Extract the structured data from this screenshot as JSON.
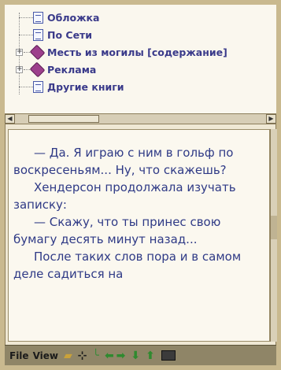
{
  "tree": {
    "items": [
      {
        "label": "Обложка",
        "icon": "document-icon",
        "expandable": false
      },
      {
        "label": "По Сети",
        "icon": "document-icon",
        "expandable": false
      },
      {
        "label": "Месть из могилы [содержание]",
        "icon": "book-icon",
        "expandable": true
      },
      {
        "label": "Реклама",
        "icon": "book-icon",
        "expandable": true
      },
      {
        "label": "Другие книги",
        "icon": "document-icon",
        "expandable": false
      }
    ]
  },
  "reader": {
    "paragraphs": [
      "— Да. Я играю с ним в гольф по воскресеньям... Ну, что скажешь?",
      "Хендерсон продолжала изучать записку:",
      "— Скажу, что ты принес свою бумагу десять минут назад...",
      "После таких слов пора и в самом деле садиться на"
    ]
  },
  "command_bar": {
    "file_label": "File",
    "view_label": "View",
    "icons": [
      "open-folder-icon",
      "split-view-icon",
      "bookmark-icon",
      "back-arrow-icon",
      "forward-arrow-icon",
      "down-arrow-icon",
      "up-arrow-icon",
      "keyboard-icon"
    ]
  },
  "colors": {
    "text": "#2f3a86",
    "tree_text": "#3a3a8a",
    "book_icon": "#9d3f8c",
    "toolbar_bg": "#8f8567",
    "arrow_green": "#2f8a2f"
  }
}
